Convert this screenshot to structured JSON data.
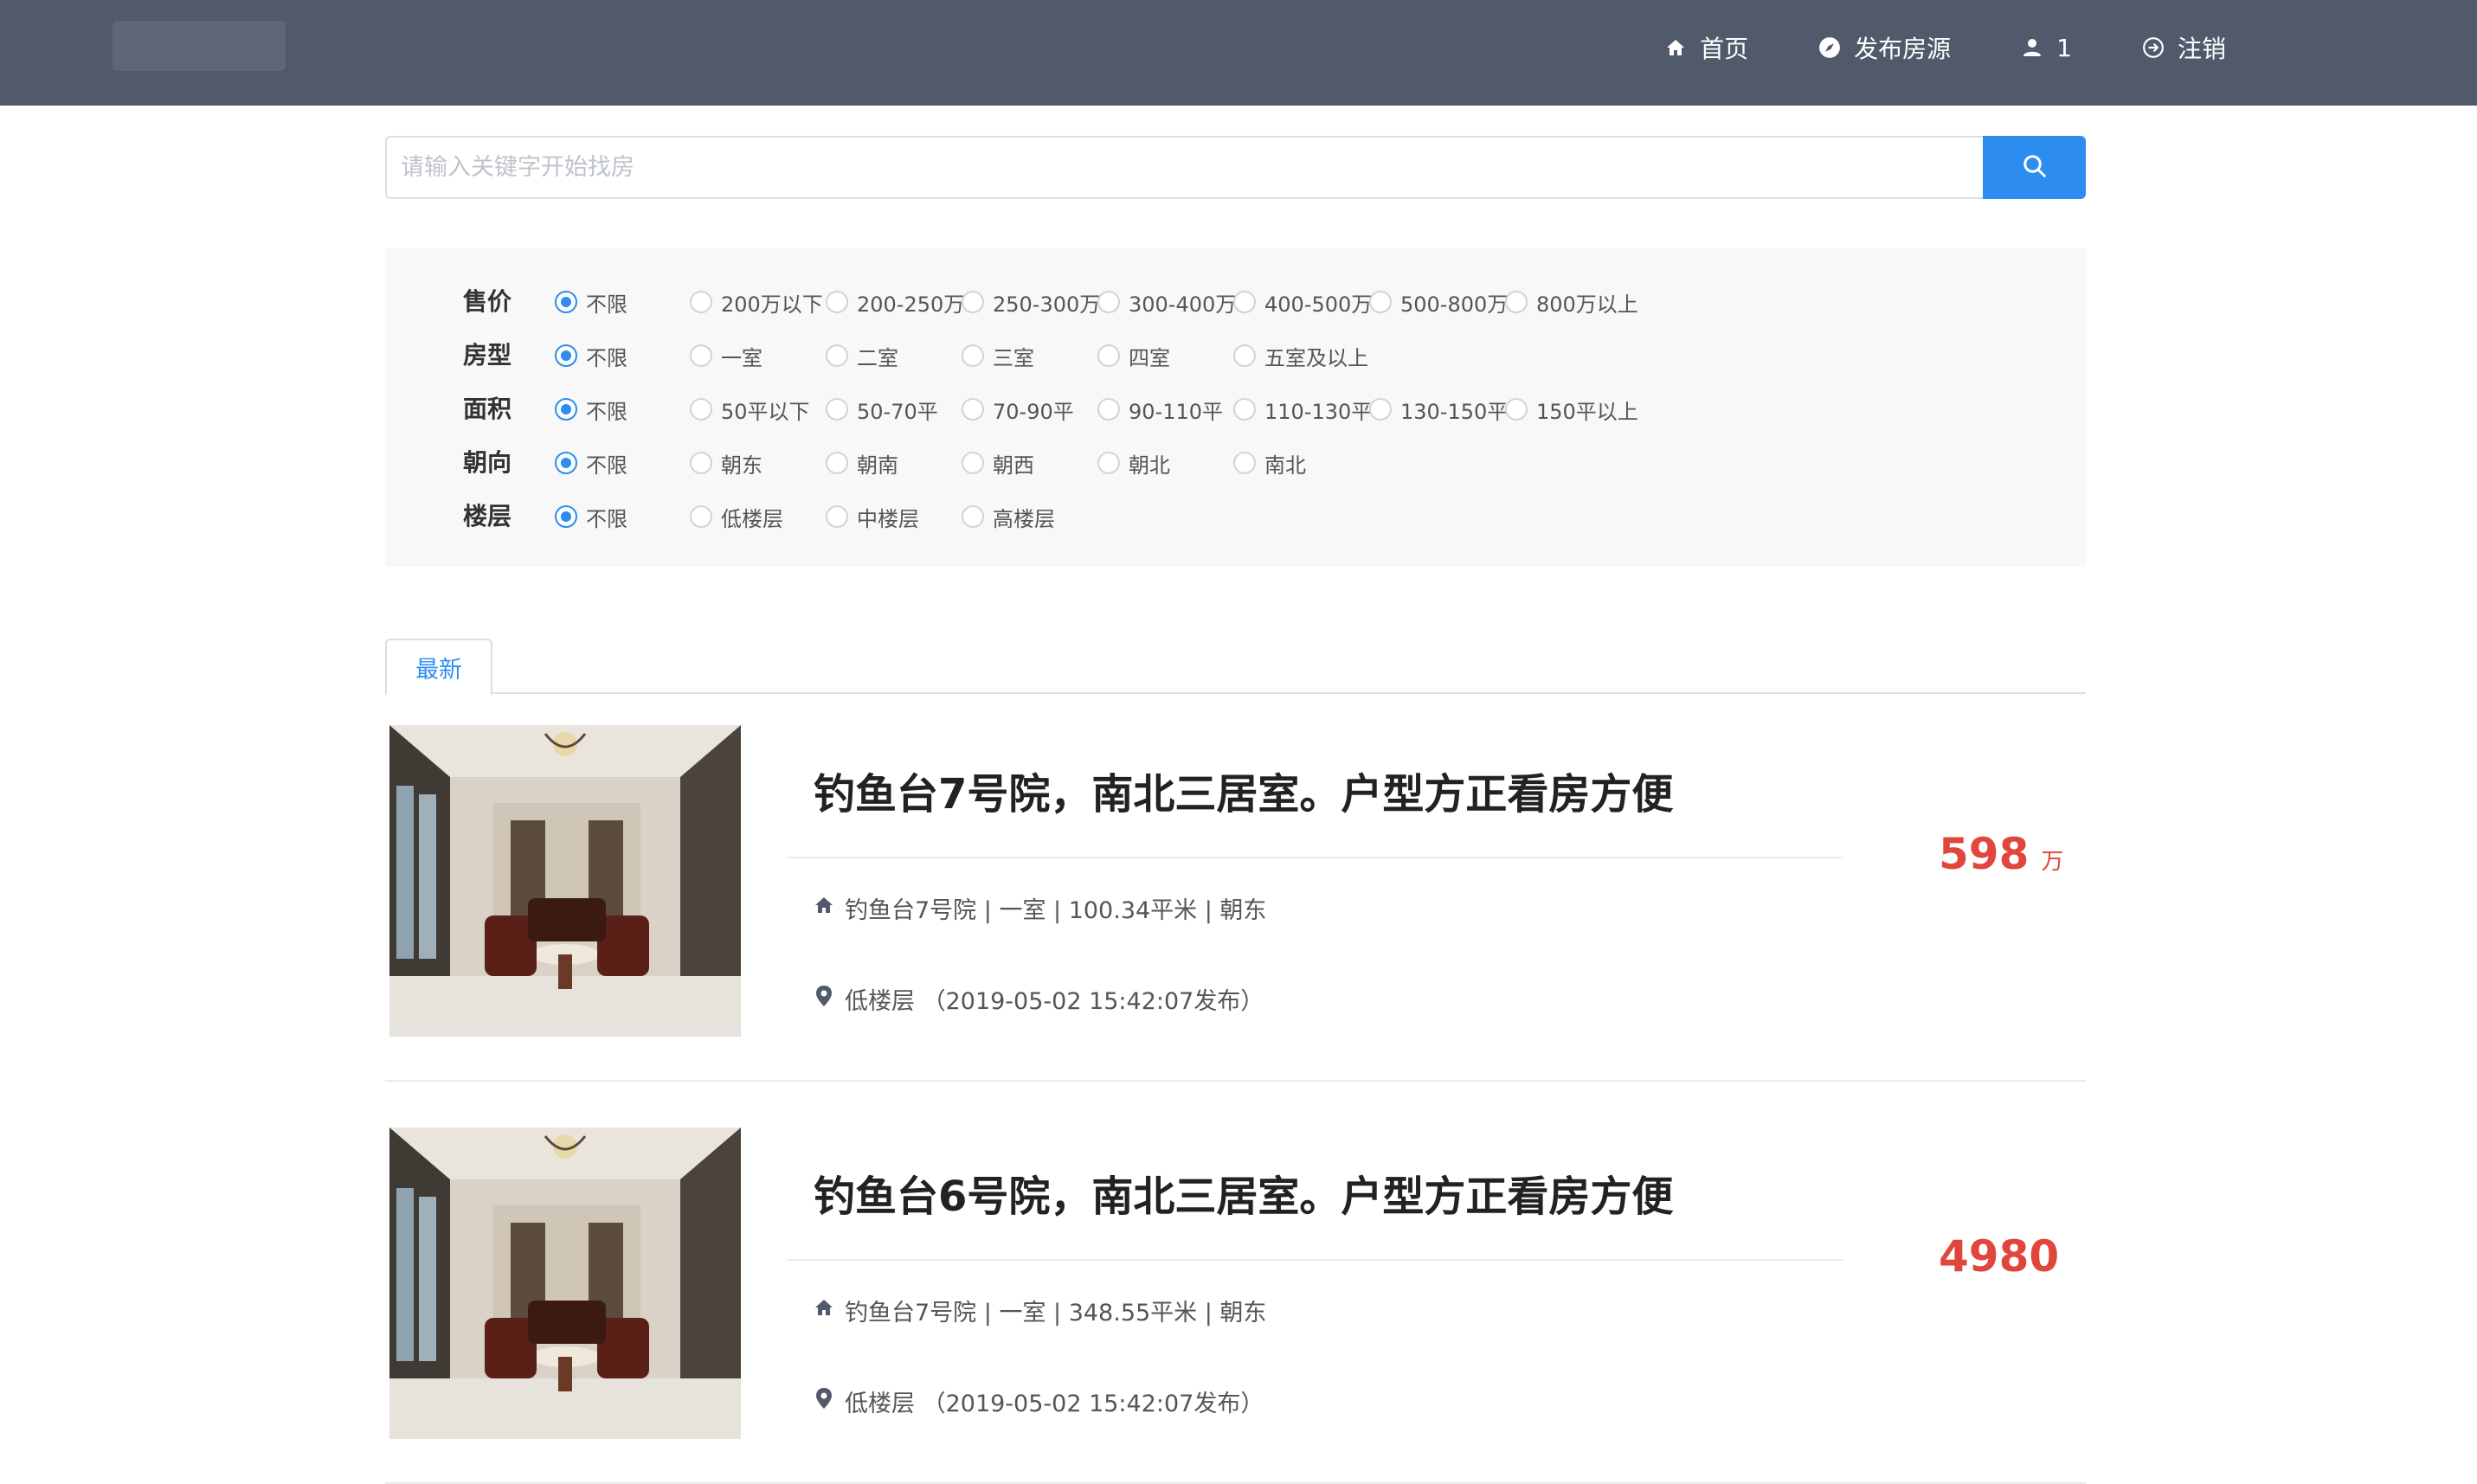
{
  "colors": {
    "topbar": "#505a6b",
    "accent": "#2d8cf0",
    "price": "#e0463c",
    "nav_text": "#ffffff"
  },
  "nav": {
    "items": [
      {
        "label": "首页",
        "icon": "home-icon"
      },
      {
        "label": "发布房源",
        "icon": "compass-icon"
      },
      {
        "label": "1",
        "icon": "user-icon"
      },
      {
        "label": "注销",
        "icon": "logout-icon"
      }
    ]
  },
  "search": {
    "placeholder": "请输入关键字开始找房",
    "value": "",
    "icon": "search-icon"
  },
  "filters": [
    {
      "label": "售价",
      "options": [
        "不限",
        "200万以下",
        "200-250万",
        "250-300万",
        "300-400万",
        "400-500万",
        "500-800万",
        "800万以上"
      ],
      "selected": 0
    },
    {
      "label": "房型",
      "options": [
        "不限",
        "一室",
        "二室",
        "三室",
        "四室",
        "五室及以上"
      ],
      "selected": 0
    },
    {
      "label": "面积",
      "options": [
        "不限",
        "50平以下",
        "50-70平",
        "70-90平",
        "90-110平",
        "110-130平",
        "130-150平",
        "150平以上"
      ],
      "selected": 0
    },
    {
      "label": "朝向",
      "options": [
        "不限",
        "朝东",
        "朝南",
        "朝西",
        "朝北",
        "南北"
      ],
      "selected": 0
    },
    {
      "label": "楼层",
      "options": [
        "不限",
        "低楼层",
        "中楼层",
        "高楼层"
      ],
      "selected": 0
    }
  ],
  "tabs": [
    {
      "label": "最新",
      "active": true
    }
  ],
  "listings": [
    {
      "title": "钓鱼台7号院，南北三居室。户型方正看房方便",
      "info": "钓鱼台7号院 | 一室 | 100.34平米 | 朝东",
      "floor": "低楼层 （2019-05-02 15:42:07发布）",
      "price": "598",
      "unit": "万"
    },
    {
      "title": "钓鱼台6号院，南北三居室。户型方正看房方便",
      "info": "钓鱼台7号院 | 一室 | 348.55平米 | 朝东",
      "floor": "低楼层 （2019-05-02 15:42:07发布）",
      "price": "4980",
      "unit": ""
    }
  ]
}
